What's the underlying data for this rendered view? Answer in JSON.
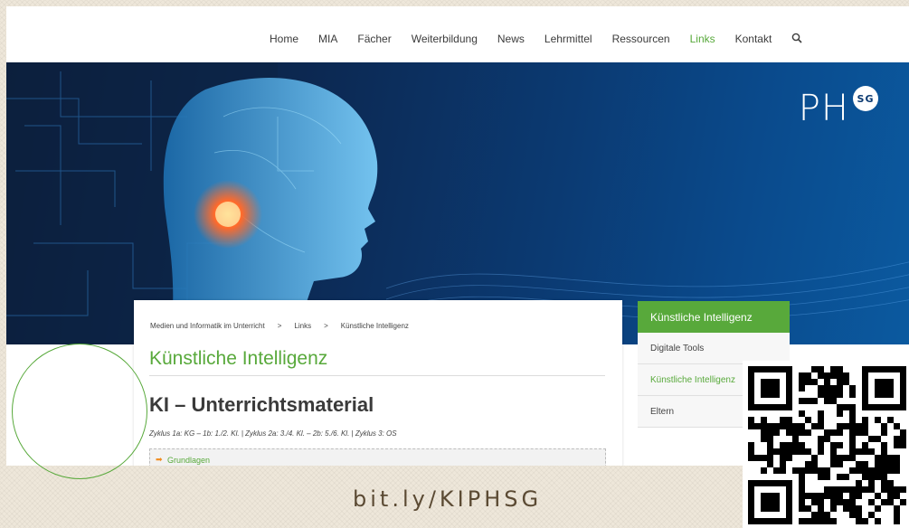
{
  "nav": {
    "items": [
      "Home",
      "MIA",
      "Fächer",
      "Weiterbildung",
      "News",
      "Lehrmittel",
      "Ressourcen",
      "Links",
      "Kontakt"
    ],
    "active": "Links",
    "search_icon": "search-icon"
  },
  "logo": {
    "text": "PH",
    "badge": "SG"
  },
  "breadcrumb": {
    "items": [
      "Medien und Informatik im Unterricht",
      "Links",
      "Künstliche Intelligenz"
    ],
    "separator": ">"
  },
  "main": {
    "page_title": "Künstliche Intelligenz",
    "heading": "KI – Unterrichtsmaterial",
    "subline": "Zyklus 1a: KG – 1b: 1./2. Kl. | Zyklus 2a: 3./4. Kl. – 2b: 5./6. Kl. | Zyklus 3: OS",
    "accordion_label": "Grundlagen"
  },
  "sidebar": {
    "header": "Künstliche Intelligenz",
    "items": [
      "Digitale Tools",
      "Künstliche Intelligenz",
      "Eltern"
    ],
    "active": "Künstliche Intelligenz"
  },
  "footer": {
    "short_url": "bit.ly/KIPHSG"
  },
  "colors": {
    "accent": "#58a93b",
    "hero_blue": "#0b3a72",
    "arrow": "#f08c1e"
  }
}
